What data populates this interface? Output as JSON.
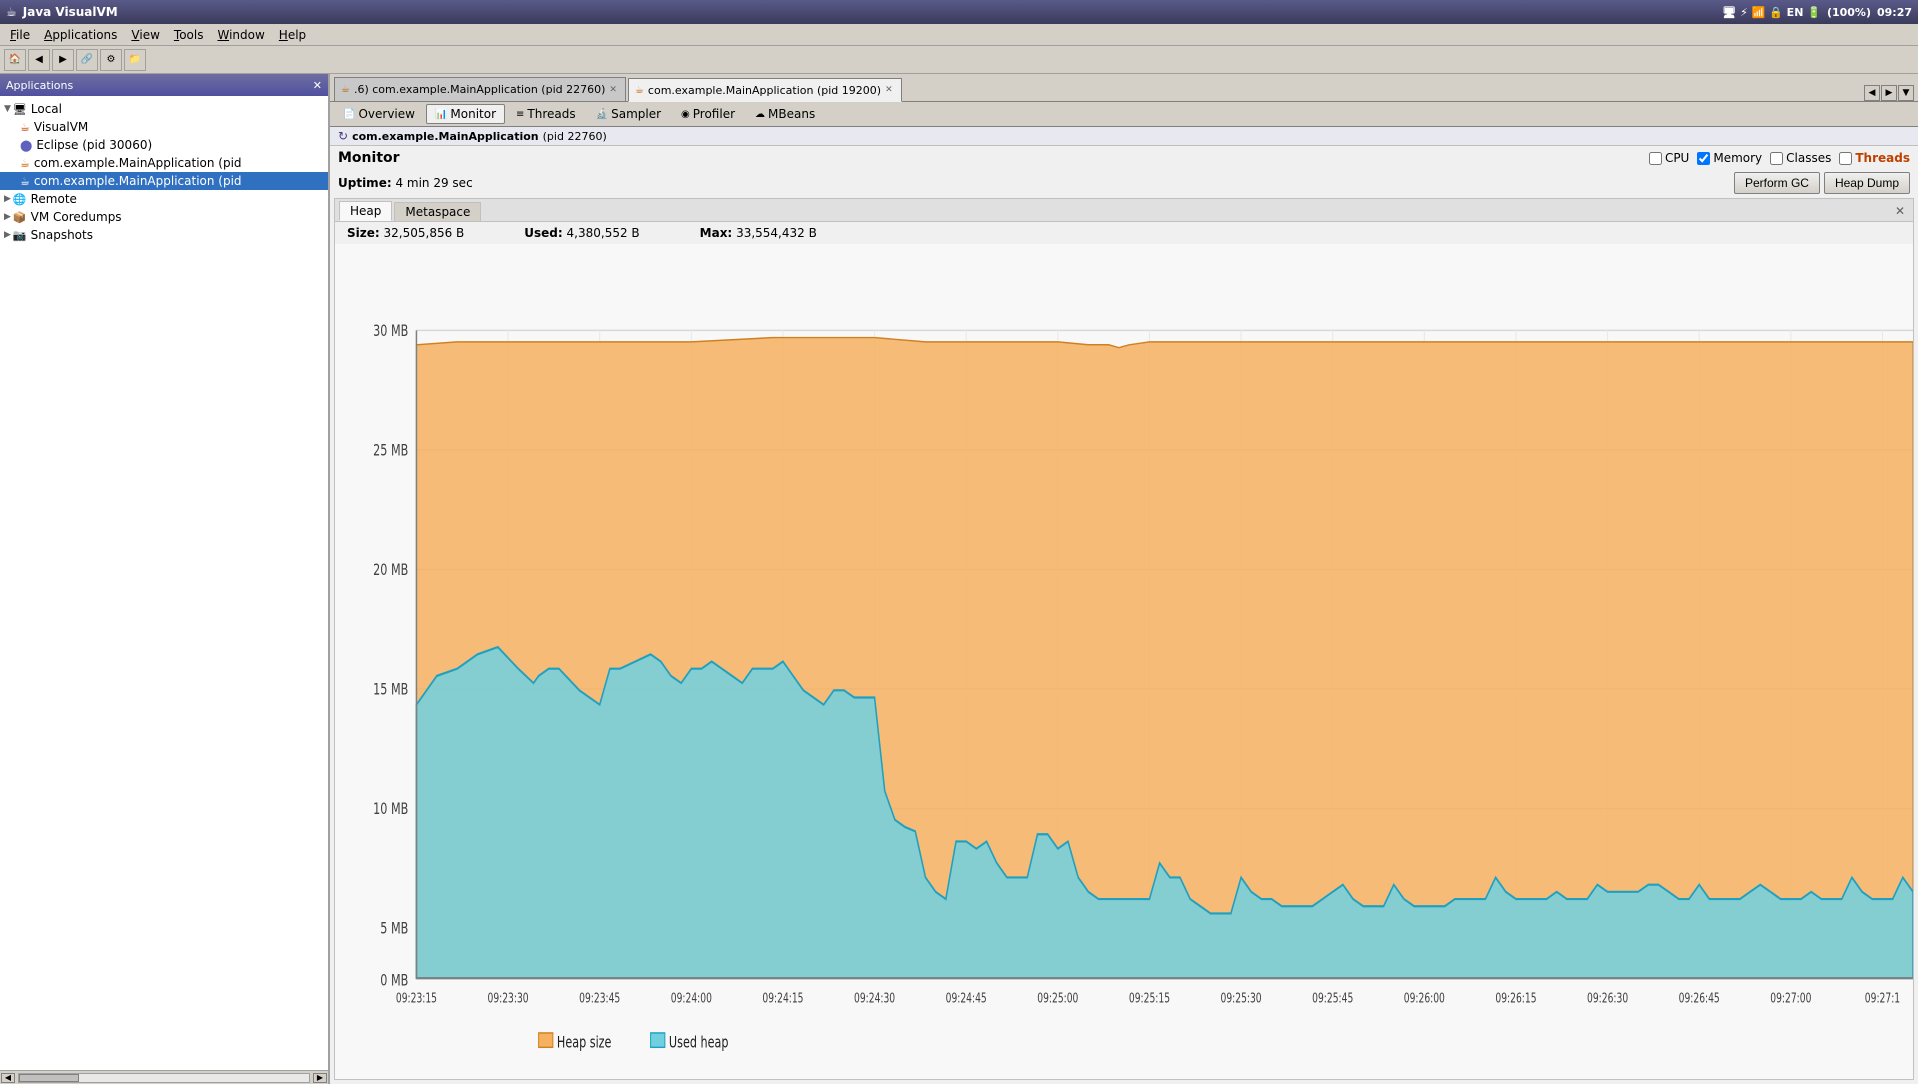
{
  "titlebar": {
    "title": "Java VisualVM",
    "time": "09:27",
    "battery": "(100%)"
  },
  "menubar": {
    "items": [
      {
        "label": "File",
        "underline": "F"
      },
      {
        "label": "Applications",
        "underline": "A"
      },
      {
        "label": "View",
        "underline": "V"
      },
      {
        "label": "Tools",
        "underline": "T"
      },
      {
        "label": "Window",
        "underline": "W"
      },
      {
        "label": "Help",
        "underline": "H"
      }
    ]
  },
  "left_panel": {
    "header": "Applications",
    "tree": [
      {
        "id": "local",
        "label": "Local",
        "indent": 0,
        "type": "folder",
        "expanded": true
      },
      {
        "id": "visualvm",
        "label": "VisualVM",
        "indent": 1,
        "type": "app"
      },
      {
        "id": "eclipse",
        "label": "Eclipse (pid 30060)",
        "indent": 1,
        "type": "app_dot"
      },
      {
        "id": "main1",
        "label": "com.example.MainApplication (pid",
        "indent": 1,
        "type": "app_orange"
      },
      {
        "id": "main2",
        "label": "com.example.MainApplication (pid",
        "indent": 1,
        "type": "app_orange_sel"
      },
      {
        "id": "remote",
        "label": "Remote",
        "indent": 0,
        "type": "folder_remote"
      },
      {
        "id": "coredumps",
        "label": "VM Coredumps",
        "indent": 0,
        "type": "folder_core"
      },
      {
        "id": "snapshots",
        "label": "Snapshots",
        "indent": 0,
        "type": "folder_snap"
      }
    ]
  },
  "file_tabs": [
    {
      "id": "tab1",
      "label": ".6) ★ com.example.MainApplication (pid 22760)",
      "active": false,
      "closable": true
    },
    {
      "id": "tab2",
      "label": "com.example.MainApplication (pid 19200)",
      "active": true,
      "closable": true
    }
  ],
  "sub_tabs": [
    {
      "id": "overview",
      "label": "Overview",
      "icon": "📄",
      "active": false
    },
    {
      "id": "monitor",
      "label": "Monitor",
      "icon": "📊",
      "active": true
    },
    {
      "id": "threads",
      "label": "Threads",
      "icon": "≡",
      "active": false
    },
    {
      "id": "sampler",
      "label": "Sampler",
      "icon": "🔬",
      "active": false
    },
    {
      "id": "profiler",
      "label": "Profiler",
      "icon": "◎",
      "active": false
    },
    {
      "id": "mbeans",
      "label": "MBeans",
      "icon": "☁",
      "active": false
    }
  ],
  "process": {
    "name": "com.example.MainApplication",
    "pid": "(pid 22760)"
  },
  "monitor": {
    "title": "Monitor",
    "uptime_label": "Uptime:",
    "uptime_value": "4 min 29 sec",
    "controls": {
      "cpu_label": "CPU",
      "memory_label": "Memory",
      "classes_label": "Classes",
      "threads_label": "Threads",
      "cpu_checked": false,
      "memory_checked": true,
      "classes_checked": false,
      "threads_checked": false
    },
    "buttons": {
      "perform_gc": "Perform GC",
      "heap_dump": "Heap Dump"
    }
  },
  "chart": {
    "tabs": [
      {
        "label": "Heap",
        "active": true
      },
      {
        "label": "Metaspace",
        "active": false
      }
    ],
    "stats": {
      "size_label": "Size:",
      "size_value": "32,505,856 B",
      "used_label": "Used:",
      "used_value": "4,380,552 B",
      "max_label": "Max:",
      "max_value": "33,554,432 B"
    },
    "y_labels": [
      "0 MB",
      "5 MB",
      "10 MB",
      "15 MB",
      "20 MB",
      "25 MB",
      "30 MB"
    ],
    "x_labels": [
      "09:23:15",
      "09:23:30",
      "09:23:45",
      "09:24:00",
      "09:24:15",
      "09:24:30",
      "09:24:45",
      "09:25:00",
      "09:25:15",
      "09:25:30",
      "09:25:45",
      "09:26:00",
      "09:26:15",
      "09:26:30",
      "09:26:45",
      "09:27:00",
      "09:27:1"
    ],
    "legend": [
      {
        "label": "Heap size",
        "color": "#f5b060"
      },
      {
        "label": "Used heap",
        "color": "#60c8d8"
      }
    ],
    "colors": {
      "heap_size_fill": "#f5c070",
      "heap_size_stroke": "#d08020",
      "used_heap_fill": "#80d8e8",
      "used_heap_stroke": "#20a0c0"
    }
  }
}
